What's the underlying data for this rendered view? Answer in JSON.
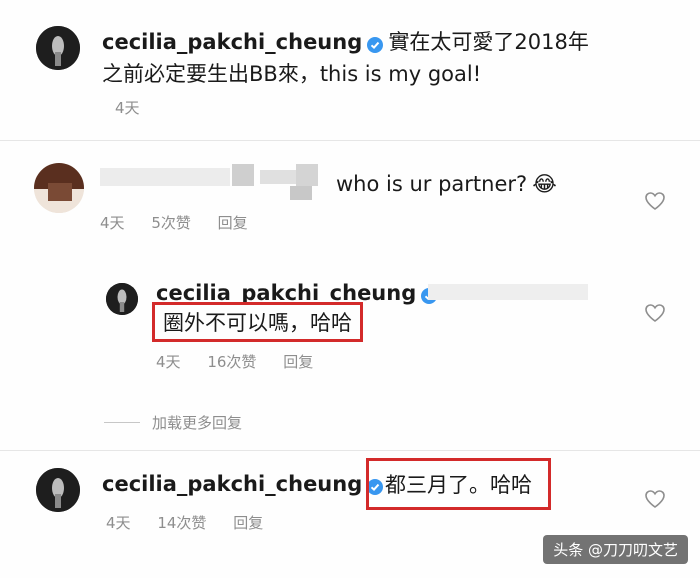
{
  "caption": {
    "username": "cecilia_pakchi_cheung",
    "text_line1": "實在太可愛了2018年",
    "text_line2": "之前必定要生出BB來，this is my goal!",
    "time": "4天"
  },
  "comment1": {
    "text": "who is ur partner?",
    "emoji": "😂",
    "time": "4天",
    "likes": "5次赞",
    "reply": "回复"
  },
  "reply1": {
    "username": "cecilia_pakchi_cheung",
    "text": "圈外不可以嗎，哈哈",
    "time": "4天",
    "likes": "16次赞",
    "reply": "回复"
  },
  "load_more": "加载更多回复",
  "comment2": {
    "username": "cecilia_pakchi_cheung",
    "text": "都三月了。哈哈",
    "time": "4天",
    "likes": "14次赞",
    "reply": "回复"
  },
  "watermark": "头条 @刀刀叨文艺",
  "colors": {
    "verified": "#3897f0",
    "highlight": "#d32a2a",
    "meta": "#8e8e8e"
  }
}
